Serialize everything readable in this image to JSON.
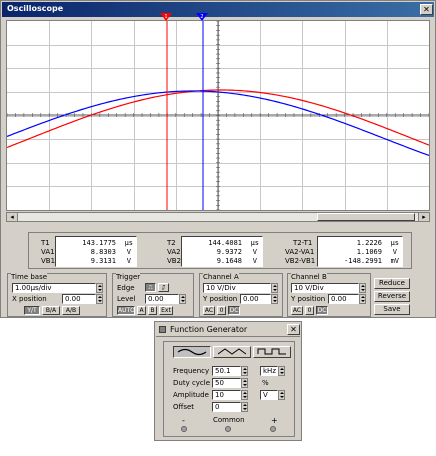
{
  "window": {
    "title": "Oscilloscope"
  },
  "measurements": {
    "t1": {
      "label": "T1",
      "value": "143.1775",
      "unit": "µs"
    },
    "va1": {
      "label": "VA1",
      "value": "8.8303",
      "unit": "V"
    },
    "vb1": {
      "label": "VB1",
      "value": "9.3131",
      "unit": "V"
    },
    "t2": {
      "label": "T2",
      "value": "144.4081",
      "unit": "µs"
    },
    "va2": {
      "label": "VA2",
      "value": "9.9372",
      "unit": "V"
    },
    "vb2": {
      "label": "VB2",
      "value": "9.1648",
      "unit": "V"
    },
    "dt": {
      "label": "T2-T1",
      "value": "1.2226",
      "unit": "µs"
    },
    "dva": {
      "label": "VA2-VA1",
      "value": "1.1069",
      "unit": "V"
    },
    "dvb": {
      "label": "VB2-VB1",
      "value": "-148.2991",
      "unit": "mV"
    }
  },
  "timebase": {
    "title": "Time base",
    "value": "1.00µs/div",
    "xpos_label": "X position",
    "xpos": "0.00",
    "modes": [
      "Y/T",
      "B/A",
      "A/B"
    ]
  },
  "trigger": {
    "title": "Trigger",
    "edge_label": "Edge",
    "level_label": "Level",
    "level": "0.00",
    "auto": "AUTO",
    "a": "A",
    "b": "B",
    "ext": "Ext"
  },
  "channel_a": {
    "title": "Channel A",
    "value": "10 V/Div",
    "ypos_label": "Y position",
    "ypos": "0.00",
    "ac": "AC",
    "zero": "0",
    "dc": "DC"
  },
  "channel_b": {
    "title": "Channel B",
    "value": "10 V/Div",
    "ypos_label": "Y position",
    "ypos": "0.00",
    "ac": "AC",
    "zero": "0",
    "dc": "DC"
  },
  "side_buttons": {
    "reduce": "Reduce",
    "reverse": "Reverse",
    "save": "Save"
  },
  "func_gen": {
    "title": "Function Generator",
    "frequency_label": "Frequency",
    "frequency": "50.1",
    "frequency_unit": "kHz",
    "duty_label": "Duty cycle",
    "duty": "50",
    "duty_unit": "%",
    "amplitude_label": "Amplitude",
    "amplitude": "10",
    "amplitude_unit": "V",
    "offset_label": "Offset",
    "offset": "0",
    "minus": "-",
    "common": "Common",
    "plus": "+"
  },
  "colors": {
    "channel_a": "#ff0000",
    "channel_b": "#0000ff",
    "cursor1": "#ff0000",
    "cursor2": "#0000ff"
  },
  "cursor_markers": {
    "c1": "1",
    "c2": "2"
  }
}
